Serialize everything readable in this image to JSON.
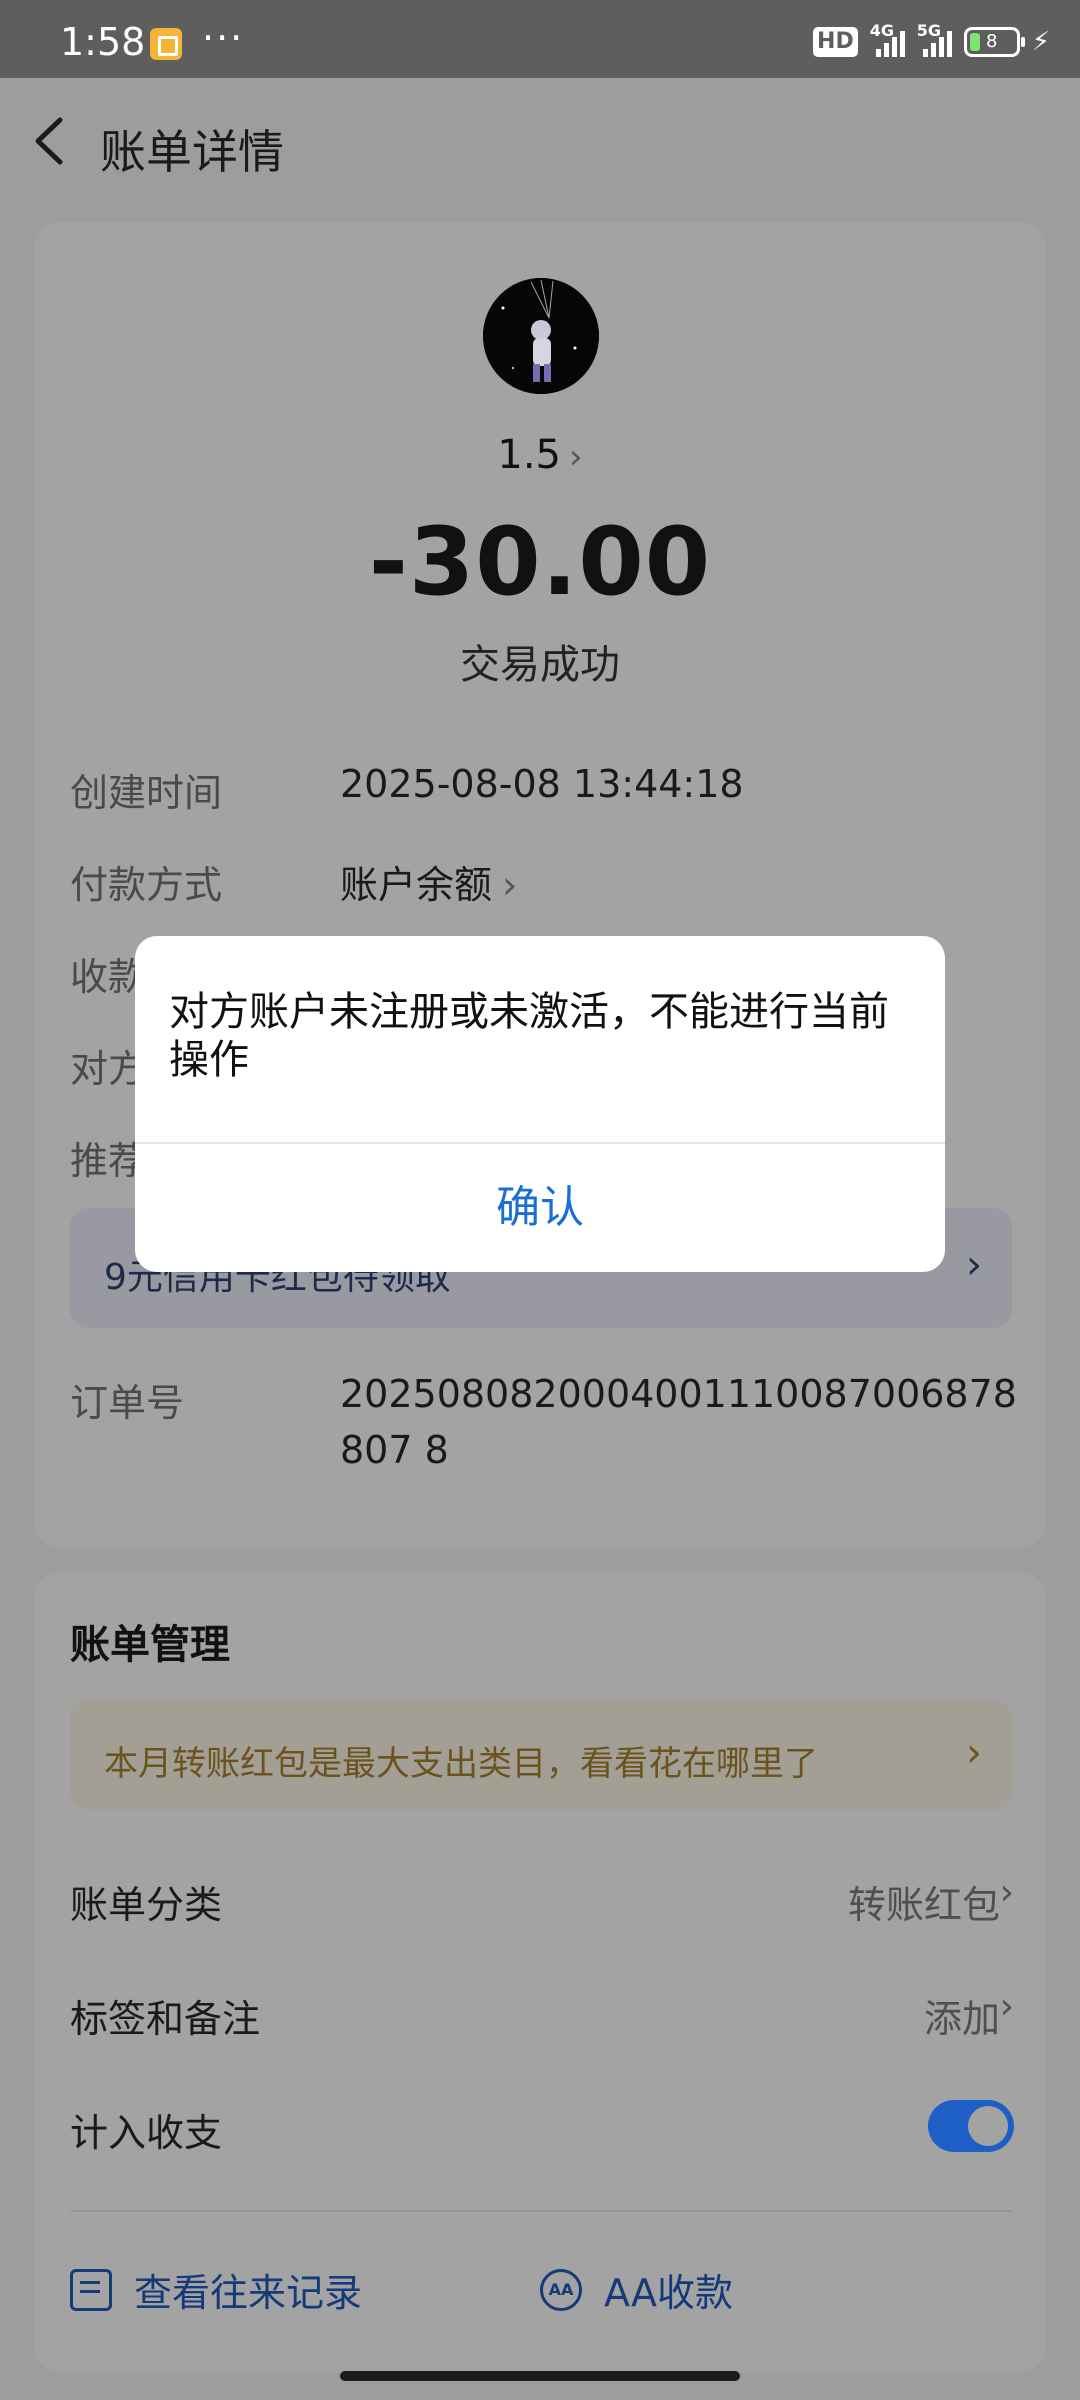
{
  "status_bar": {
    "time": "1:58",
    "more": "···",
    "hd": "HD",
    "net1": "4G",
    "net2": "5G",
    "battery": "8"
  },
  "header": {
    "title": "账单详情"
  },
  "transaction": {
    "payee_name": "1.5",
    "amount": "-30.00",
    "status": "交易成功",
    "rows": [
      {
        "label": "创建时间",
        "value": "2025-08-08 13:44:18"
      },
      {
        "label": "付款方式",
        "value": "账户余额"
      },
      {
        "label": "收款",
        "value": ""
      },
      {
        "label": "对方",
        "value": ""
      },
      {
        "label": "推荐",
        "value": ""
      }
    ],
    "promo": "9元信用卡红包待领取",
    "order_label": "订单号",
    "order_number": "2025080820004001110087006878807 8"
  },
  "bill_management": {
    "title": "账单管理",
    "tip": "本月转账红包是最大支出类目，看看花在哪里了",
    "category_label": "账单分类",
    "category_value": "转账红包",
    "tags_label": "标签和备注",
    "tags_value": "添加",
    "count_label": "计入收支",
    "count_enabled": true,
    "records_label": "查看往来记录",
    "aa_label": "AA收款",
    "aa_icon_text": "AA"
  },
  "dialog": {
    "message": "对方账户未注册或未激活，不能进行当前操作",
    "confirm": "确认"
  },
  "colors": {
    "accent": "#1a6fd6",
    "toggle_on": "#1d5fc4",
    "tip_text": "#6b531e"
  }
}
